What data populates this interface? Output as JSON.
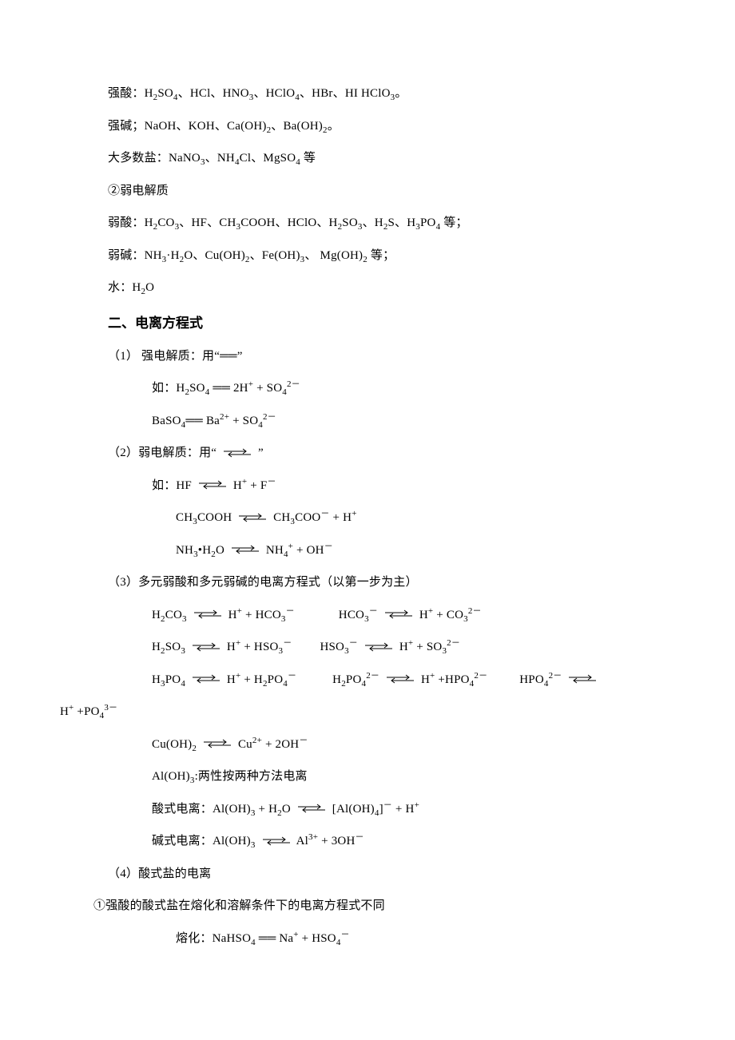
{
  "lines": {
    "l1": "强酸：H₂SO₄、HCl、HNO₃、HClO₄、HBr、HI HClO₃。",
    "l2": "强碱；NaOH、KOH、Ca(OH)₂、Ba(OH)₂。",
    "l3": "大多数盐：NaNO₃、NH₄Cl、MgSO₄ 等",
    "l4": "②弱电解质",
    "l5": "弱酸：H₂CO₃、HF、CH₃COOH、HClO、H₂SO₃、H₂S、H₃PO₄ 等；",
    "l6": "弱碱：NH₃·H₂O、Cu(OH)₂、Fe(OH)₃、  Mg(OH)₂ 等；",
    "l7": "水：H₂O",
    "h2": "二、电离方程式",
    "l8a": "（1）  强电解质：用“",
    "l8b": "”",
    "l9a": "如：H₂SO₄ ",
    "l9b": " 2H⁺ + SO₄²⁻",
    "l10a": "BaSO₄",
    "l10b": "  Ba²⁺ + SO₄²⁻",
    "l11a": "（2）弱电解质：用“ ",
    "l11b": " ”",
    "l12a": "如：HF  ",
    "l12b": "  H⁺ + F⁻",
    "l13a": "CH₃COOH  ",
    "l13b": "  CH₃COO⁻ + H⁺",
    "l14a": "NH₃•H₂O  ",
    "l14b": "  NH₄⁺ + OH⁻",
    "l15": "（3）多元弱酸和多元弱碱的电离方程式（以第一步为主）",
    "l16a": "H₂CO₃ ",
    "l16b": " H⁺ + HCO₃⁻",
    "l16c": "HCO₃⁻ ",
    "l16d": " H⁺ + CO₃²⁻",
    "l17a": "H₂SO₃ ",
    "l17b": "  H⁺ +   HSO₃⁻",
    "l17c": "HSO₃⁻ ",
    "l17d": " H⁺ + SO₃²⁻",
    "l18a": "H₃PO₄ ",
    "l18b": " H⁺ + H₂PO₄⁻",
    "l18c": "H₂PO₄²⁻  ",
    "l18d": " H⁺ +HPO₄²⁻",
    "l18e": "HPO₄²⁻  ",
    "l18f": "",
    "l18g": "H⁺ +PO₄³⁻",
    "l19a": "Cu(OH)₂ ",
    "l19b": " Cu²⁺ + 2OH⁻",
    "l20": "Al(OH)₃:两性按两种方法电离",
    "l21a": "酸式电离：Al(OH)₃ + H₂O  ",
    "l21b": "  [Al(OH)₄]⁻ + H⁺",
    "l22a": "碱式电离：Al(OH)₃  ",
    "l22b": "   Al³⁺ +   3OH⁻",
    "l23": "（4）酸式盐的电离",
    "l24": "①强酸的酸式盐在熔化和溶解条件下的电离方程式不同",
    "l25a": "熔化：NaHSO₄ ",
    "l25b": " Na⁺ + HSO₄⁻"
  }
}
